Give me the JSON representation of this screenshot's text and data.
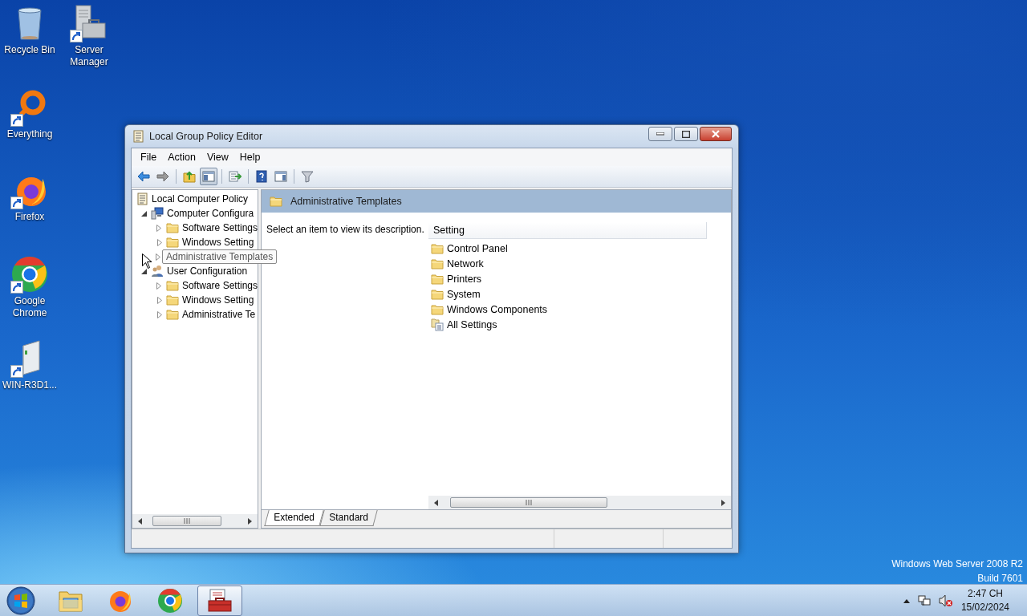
{
  "desktop_icons": [
    {
      "label": "Recycle Bin"
    },
    {
      "label": "Server Manager"
    },
    {
      "label": "Everything"
    },
    {
      "label": "Firefox"
    },
    {
      "label": "Google Chrome"
    },
    {
      "label": "WIN-R3D1..."
    }
  ],
  "window": {
    "title": "Local Group Policy Editor",
    "menu": [
      "File",
      "Action",
      "View",
      "Help"
    ],
    "toolbar": [
      {
        "pressed": false
      },
      {
        "pressed": false
      },
      {
        "pressed": false
      },
      {
        "pressed": true
      },
      {
        "pressed": false
      },
      {
        "pressed": false
      },
      {
        "pressed": false
      },
      {
        "pressed": false
      }
    ],
    "tree": [
      {
        "label": "Local Computer Policy",
        "kind": "policy",
        "children": [
          {
            "label": "Computer Configura",
            "kind": "computer",
            "expanded": true,
            "children": [
              {
                "label": "Software Settings",
                "kind": "folder",
                "expanded": false
              },
              {
                "label": "Windows Setting",
                "kind": "folder",
                "expanded": false
              },
              {
                "label": "Administrative Templates",
                "kind": "folder",
                "expanded": false,
                "hovered": true
              }
            ]
          },
          {
            "label": "User Configuration",
            "kind": "user",
            "expanded": true,
            "children": [
              {
                "label": "Software Settings",
                "kind": "folder",
                "expanded": false
              },
              {
                "label": "Windows Setting",
                "kind": "folder",
                "expanded": false
              },
              {
                "label": "Administrative Te",
                "kind": "folder",
                "expanded": false
              }
            ]
          }
        ]
      }
    ],
    "header": "Administrative Templates",
    "description": "Select an item to view its description.",
    "list": {
      "column": "Setting",
      "items": [
        {
          "label": "Control Panel",
          "kind": "folder"
        },
        {
          "label": "Network",
          "kind": "folder"
        },
        {
          "label": "Printers",
          "kind": "folder"
        },
        {
          "label": "System",
          "kind": "folder"
        },
        {
          "label": "Windows Components",
          "kind": "folder"
        },
        {
          "label": "All Settings",
          "kind": "settings"
        }
      ]
    },
    "tabs": [
      {
        "label": "Extended",
        "selected": true
      },
      {
        "label": "Standard",
        "selected": false
      }
    ]
  },
  "os_info": [
    "Windows Web Server 2008 R2",
    "Build 7601"
  ],
  "taskbar": {
    "buttons": [
      {
        "active": false
      },
      {
        "active": false
      },
      {
        "active": false
      },
      {
        "active": true
      }
    ],
    "clock": {
      "time": "2:47 CH",
      "date": "15/02/2024"
    }
  }
}
